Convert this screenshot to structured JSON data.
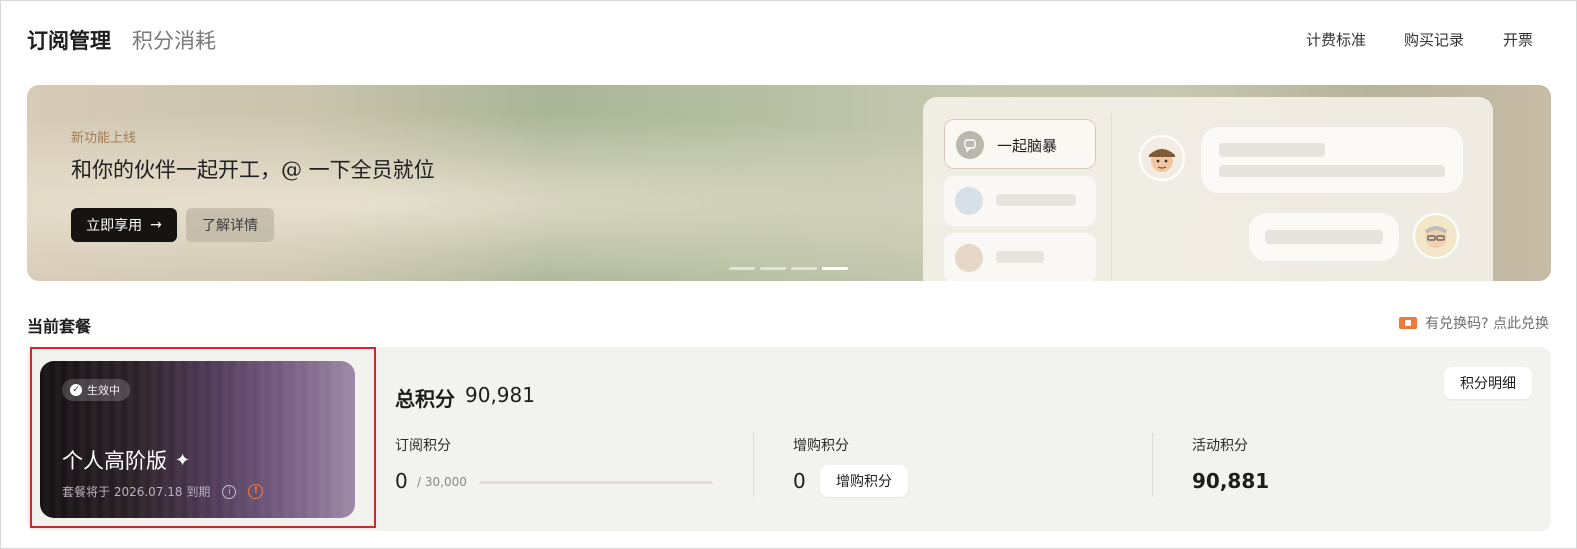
{
  "header": {
    "tabs": [
      {
        "label": "订阅管理",
        "active": true
      },
      {
        "label": "积分消耗",
        "active": false
      }
    ],
    "links": [
      "计费标准",
      "购买记录",
      "开票"
    ]
  },
  "banner": {
    "kicker": "新功能上线",
    "headline": "和你的伙伴一起开工，@ 一下全员就位",
    "primary_button": "立即享用",
    "secondary_button": "了解详情",
    "carousel_total": 4,
    "carousel_active": 4,
    "mock_chip_label": "一起脑暴"
  },
  "current_plan": {
    "section_title": "当前套餐",
    "redeem_link": "有兑换码? 点此兑换",
    "card": {
      "status": "生效中",
      "name": "个人高阶版",
      "expiry": "套餐将于 2026.07.18 到期"
    },
    "total_label": "总积分",
    "total_value": "90,981",
    "detail_button": "积分明细",
    "columns": {
      "subscription": {
        "label": "订阅积分",
        "value": "0",
        "quota": "/ 30,000",
        "used_fraction": 0
      },
      "purchased": {
        "label": "增购积分",
        "value": "0",
        "button": "增购积分"
      },
      "activity": {
        "label": "活动积分",
        "value": "90,881"
      }
    }
  },
  "colors": {
    "accent_red_outline": "#d8222e",
    "warning_orange": "#f07a3a",
    "dark_button": "#151412"
  }
}
